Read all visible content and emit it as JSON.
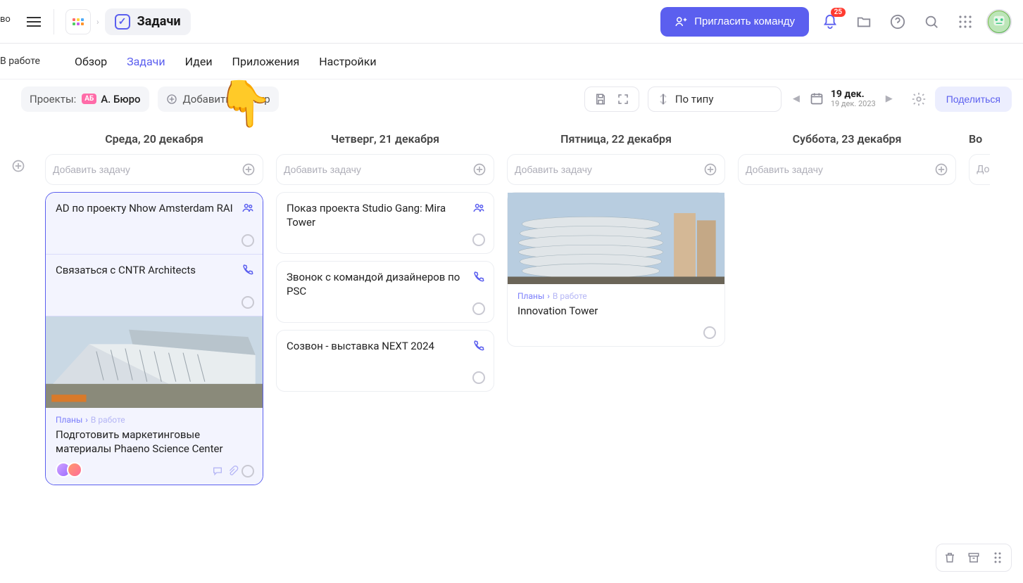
{
  "header": {
    "cut_label_top": "во",
    "page_title": "Задачи",
    "invite_label": "Пригласить команду",
    "notifications_badge": "25"
  },
  "tabs": {
    "cut_label": "В работе",
    "items": [
      "Обзор",
      "Задачи",
      "Идеи",
      "Приложения",
      "Настройки"
    ],
    "active_index": 1
  },
  "toolbar": {
    "projects_label": "Проекты:",
    "project_badge": "АБ",
    "project_name": "А. Бюро",
    "add_filter": "Добавить фильтр",
    "sort_label": "По типу",
    "date_main": "19 дек.",
    "date_sub": "19 дек. 2023",
    "share_label": "Поделиться"
  },
  "board": {
    "add_task_placeholder": "Добавить задачу",
    "columns": [
      {
        "title": "Среда, 20 декабря"
      },
      {
        "title": "Четверг, 21 декабря"
      },
      {
        "title": "Пятница, 22 декабря"
      },
      {
        "title": "Суббота, 23 декабря"
      }
    ],
    "next_col_title_cut": "Во",
    "next_col_placeholder_cut": "До"
  },
  "cards": {
    "wed": [
      {
        "title": "AD по проекту Nhow Amsterdam RAI",
        "icon": "team"
      },
      {
        "title": "Связаться с CNTR Architects",
        "icon": "phone"
      },
      {
        "title": "Подготовить маркетинговые материалы Phaeno Science Center",
        "breadcrumb1": "Планы",
        "breadcrumb2": "В работе",
        "has_image": true
      }
    ],
    "thu": [
      {
        "title": "Показ проекта Studio Gang: Mira Tower",
        "icon": "team"
      },
      {
        "title": "Звонок с командой дизайнеров по PSC",
        "icon": "phone"
      },
      {
        "title": "Созвон - выставка NEXT 2024",
        "icon": "phone"
      }
    ],
    "fri": [
      {
        "title": "Innovation Tower",
        "breadcrumb1": "Планы",
        "breadcrumb2": "В работе",
        "has_image": true
      }
    ]
  }
}
